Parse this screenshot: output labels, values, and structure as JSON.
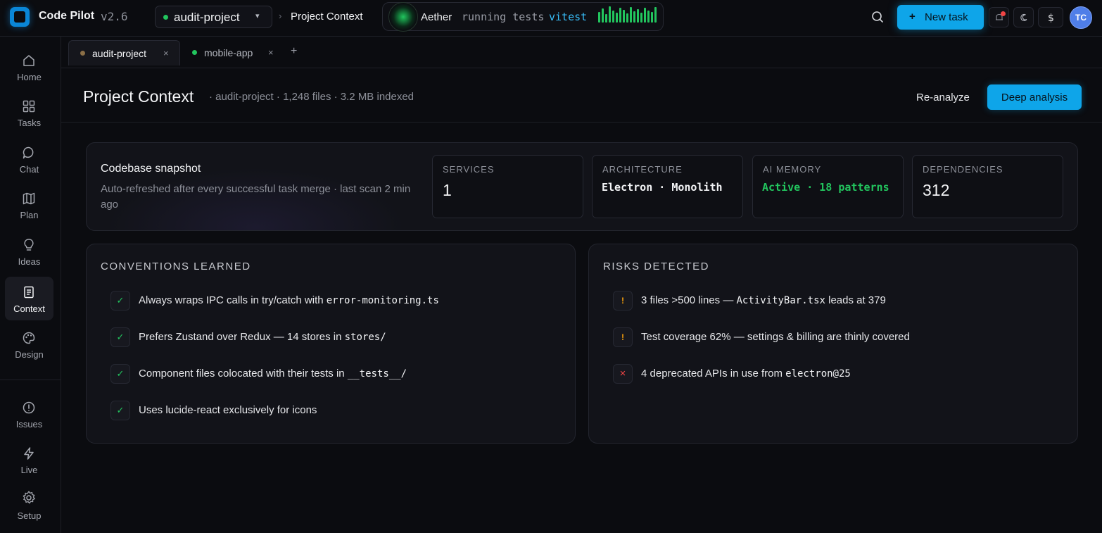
{
  "app": {
    "title": "Code Pilot",
    "version": "v2.6"
  },
  "project_selector": {
    "value": "audit-project"
  },
  "breadcrumb": {
    "current": "Project Context"
  },
  "agent": {
    "name": "Aether",
    "status": "running tests",
    "tool": "vitest",
    "activity_levels": [
      0.55,
      0.8,
      0.4,
      0.95,
      0.65,
      0.5,
      0.85,
      0.7,
      0.45,
      0.9,
      0.6,
      0.75,
      0.5,
      0.85,
      0.65,
      0.55,
      0.9
    ]
  },
  "header_actions": {
    "new_task_label": "New task",
    "avatar_initials": "TC"
  },
  "sidebar": {
    "items": [
      {
        "id": "home",
        "label": "Home",
        "icon": "home-icon"
      },
      {
        "id": "tasks",
        "label": "Tasks",
        "icon": "grid-icon"
      },
      {
        "id": "chat",
        "label": "Chat",
        "icon": "chat-icon"
      },
      {
        "id": "plan",
        "label": "Plan",
        "icon": "map-icon"
      },
      {
        "id": "ideas",
        "label": "Ideas",
        "icon": "lightbulb-icon"
      },
      {
        "id": "context",
        "label": "Context",
        "icon": "document-icon",
        "active": true
      },
      {
        "id": "design",
        "label": "Design",
        "icon": "palette-icon"
      }
    ],
    "bottom_items": [
      {
        "id": "issues",
        "label": "Issues",
        "icon": "alert-circle-icon"
      },
      {
        "id": "live",
        "label": "Live",
        "icon": "lightning-icon"
      },
      {
        "id": "setup",
        "label": "Setup",
        "icon": "gear-icon"
      }
    ]
  },
  "tabs": [
    {
      "name": "audit-project",
      "active": true,
      "status_color": "#8b6f47"
    },
    {
      "name": "mobile-app",
      "active": false,
      "status_color": "#22c55e"
    }
  ],
  "page": {
    "title": "Project Context",
    "meta_project": "audit-project",
    "meta_files": "1,248 files",
    "meta_size": "3.2 MB indexed",
    "reanalyze_label": "Re-analyze",
    "deep_analysis_label": "Deep analysis"
  },
  "snapshot": {
    "title": "Codebase snapshot",
    "subtitle": "Auto-refreshed after every successful task merge · last scan 2 min ago",
    "stats": [
      {
        "label": "SERVICES",
        "value": "1"
      },
      {
        "label": "ARCHITECTURE",
        "value": "Electron · Monolith"
      },
      {
        "label": "AI MEMORY",
        "value": "Active · 18 patterns"
      },
      {
        "label": "DEPENDENCIES",
        "value": "312"
      }
    ]
  },
  "conventions": {
    "title": "CONVENTIONS LEARNED",
    "items": [
      {
        "text": "Always wraps IPC calls in try/catch with ",
        "code": "error-monitoring.ts",
        "after": ""
      },
      {
        "text": "Prefers Zustand over Redux — 14 stores in ",
        "code": "stores/",
        "after": ""
      },
      {
        "text": "Component files colocated with their tests in ",
        "code": "__tests__/",
        "after": ""
      },
      {
        "text": "Uses lucide-react exclusively for icons",
        "code": "",
        "after": ""
      }
    ]
  },
  "risks": {
    "title": "RISKS DETECTED",
    "items": [
      {
        "level": "warn",
        "text": "3 files >500 lines — ",
        "code": "ActivityBar.tsx",
        "after": " leads at 379"
      },
      {
        "level": "warn",
        "text": "Test coverage 62% — settings & billing are thinly covered",
        "code": "",
        "after": ""
      },
      {
        "level": "error",
        "text": "4 deprecated APIs in use from ",
        "code": "electron@25",
        "after": ""
      }
    ]
  },
  "colors": {
    "accent": "#0ea5e9",
    "success": "#22c55e",
    "warning": "#f59e0b",
    "danger": "#ef4444"
  }
}
